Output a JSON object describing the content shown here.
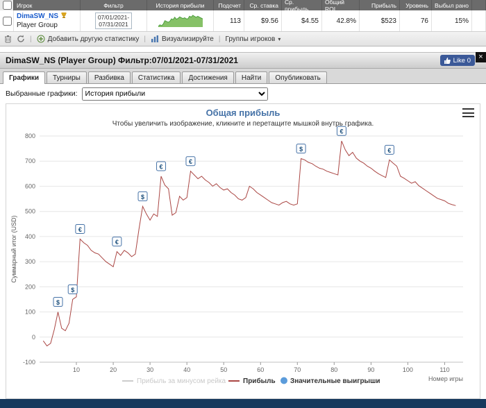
{
  "colors": {
    "profit_line": "#AA4643",
    "disabled_series": "#cccccc",
    "marker_dot": "#5B9CDB",
    "marker_border": "#4572A7",
    "facebook_blue": "#3b5998",
    "footer_navy": "#17395d",
    "player_link_blue": "#1a5ccc",
    "sparkline_green": "#86C167"
  },
  "table": {
    "headers": {
      "player": "Игрок",
      "filter": "Фильтр",
      "history": "История прибыли",
      "count": "Подсчет",
      "avg_stake": "Ср. ставка",
      "avg_profit": "Ср. прибыль",
      "roi": "Общий ROI",
      "profit": "Прибыль",
      "level": "Уровень",
      "busted": "Выбыл рано"
    },
    "row": {
      "player": "DimaSW_NS",
      "group": "Player Group",
      "filter_line1": "07/01/2021-",
      "filter_line2": "07/31/2021",
      "count": "113",
      "avg_stake": "$9.56",
      "avg_profit": "$4.55",
      "roi": "42.8%",
      "profit": "$523",
      "level": "76",
      "busted": "15%"
    },
    "sparkline": [
      -15,
      100,
      35,
      150,
      390,
      340,
      280,
      345,
      520,
      465,
      640,
      495,
      555,
      660,
      600,
      545,
      600,
      525,
      530,
      710,
      650,
      780,
      700,
      635,
      705,
      640,
      580,
      523
    ]
  },
  "toolbar": {
    "add_stat": "Добавить другую статистику",
    "visualize": "Визуализируйте",
    "groups": "Группы игроков"
  },
  "panel": {
    "title": "DimaSW_NS (Player Group) Фильтр:07/01/2021-07/31/2021",
    "like": "Like 0",
    "close": "×",
    "tabs": [
      "Графики",
      "Турниры",
      "Разбивка",
      "Статистика",
      "Достижения",
      "Найти",
      "Опубликовать"
    ],
    "active_tab": "Графики",
    "graphs_label": "Выбранные графики:",
    "graph_selected": "История прибыли"
  },
  "chart_data": {
    "type": "line",
    "title": "Общая прибыль",
    "subtitle": "Чтобы увеличить изображение, кликните и перетащите мышкой внутрь графика.",
    "ylabel": "Суммарный итог (USD)",
    "xlabel": "Номер игры",
    "xlim": [
      0,
      115
    ],
    "ylim": [
      -100,
      800
    ],
    "xticks": [
      10,
      20,
      30,
      40,
      50,
      60,
      70,
      80,
      90,
      100,
      110
    ],
    "yticks": [
      -100,
      0,
      100,
      200,
      300,
      400,
      500,
      600,
      700,
      800
    ],
    "grid": "horizontal",
    "legend_position": "bottom",
    "series": [
      {
        "name": "Прибыль за минусом рейка",
        "color": "#cccccc",
        "visible": false,
        "points": []
      },
      {
        "name": "Прибыль",
        "color": "#AA4643",
        "visible": true,
        "points": [
          [
            1,
            -15
          ],
          [
            2,
            -35
          ],
          [
            3,
            -25
          ],
          [
            4,
            30
          ],
          [
            5,
            100
          ],
          [
            6,
            35
          ],
          [
            7,
            25
          ],
          [
            8,
            55
          ],
          [
            9,
            150
          ],
          [
            10,
            160
          ],
          [
            11,
            390
          ],
          [
            12,
            375
          ],
          [
            13,
            365
          ],
          [
            14,
            345
          ],
          [
            15,
            335
          ],
          [
            16,
            330
          ],
          [
            17,
            315
          ],
          [
            18,
            300
          ],
          [
            19,
            290
          ],
          [
            20,
            280
          ],
          [
            21,
            340
          ],
          [
            22,
            325
          ],
          [
            23,
            345
          ],
          [
            24,
            335
          ],
          [
            25,
            320
          ],
          [
            26,
            330
          ],
          [
            27,
            430
          ],
          [
            28,
            520
          ],
          [
            29,
            490
          ],
          [
            30,
            465
          ],
          [
            31,
            490
          ],
          [
            32,
            480
          ],
          [
            33,
            640
          ],
          [
            34,
            605
          ],
          [
            35,
            590
          ],
          [
            36,
            485
          ],
          [
            37,
            495
          ],
          [
            38,
            560
          ],
          [
            39,
            545
          ],
          [
            40,
            555
          ],
          [
            41,
            660
          ],
          [
            42,
            645
          ],
          [
            43,
            630
          ],
          [
            44,
            640
          ],
          [
            45,
            625
          ],
          [
            46,
            615
          ],
          [
            47,
            600
          ],
          [
            48,
            610
          ],
          [
            49,
            595
          ],
          [
            50,
            585
          ],
          [
            51,
            590
          ],
          [
            52,
            575
          ],
          [
            53,
            565
          ],
          [
            54,
            550
          ],
          [
            55,
            545
          ],
          [
            56,
            555
          ],
          [
            57,
            600
          ],
          [
            58,
            590
          ],
          [
            59,
            575
          ],
          [
            60,
            565
          ],
          [
            61,
            555
          ],
          [
            62,
            545
          ],
          [
            63,
            535
          ],
          [
            64,
            530
          ],
          [
            65,
            525
          ],
          [
            66,
            535
          ],
          [
            67,
            540
          ],
          [
            68,
            530
          ],
          [
            69,
            525
          ],
          [
            70,
            530
          ],
          [
            71,
            710
          ],
          [
            72,
            705
          ],
          [
            73,
            695
          ],
          [
            74,
            690
          ],
          [
            75,
            680
          ],
          [
            76,
            672
          ],
          [
            77,
            668
          ],
          [
            78,
            660
          ],
          [
            79,
            655
          ],
          [
            80,
            650
          ],
          [
            81,
            645
          ],
          [
            82,
            780
          ],
          [
            83,
            745
          ],
          [
            84,
            722
          ],
          [
            85,
            735
          ],
          [
            86,
            712
          ],
          [
            87,
            700
          ],
          [
            88,
            692
          ],
          [
            89,
            680
          ],
          [
            90,
            672
          ],
          [
            91,
            660
          ],
          [
            92,
            650
          ],
          [
            93,
            642
          ],
          [
            94,
            635
          ],
          [
            95,
            705
          ],
          [
            96,
            692
          ],
          [
            97,
            680
          ],
          [
            98,
            640
          ],
          [
            99,
            632
          ],
          [
            100,
            622
          ],
          [
            101,
            612
          ],
          [
            102,
            618
          ],
          [
            103,
            602
          ],
          [
            104,
            592
          ],
          [
            105,
            582
          ],
          [
            106,
            572
          ],
          [
            107,
            562
          ],
          [
            108,
            552
          ],
          [
            109,
            547
          ],
          [
            110,
            542
          ],
          [
            111,
            532
          ],
          [
            112,
            527
          ],
          [
            113,
            523
          ]
        ]
      }
    ],
    "markers": {
      "name": "Значительные выигрыши",
      "color": "#5B9CDB",
      "border": "#4572A7",
      "items": [
        {
          "x": 5,
          "y": 100,
          "symbol": "$"
        },
        {
          "x": 9,
          "y": 150,
          "symbol": "$"
        },
        {
          "x": 11,
          "y": 390,
          "symbol": "€"
        },
        {
          "x": 21,
          "y": 340,
          "symbol": "€"
        },
        {
          "x": 28,
          "y": 520,
          "symbol": "$"
        },
        {
          "x": 33,
          "y": 640,
          "symbol": "€"
        },
        {
          "x": 41,
          "y": 660,
          "symbol": "€"
        },
        {
          "x": 71,
          "y": 710,
          "symbol": "$"
        },
        {
          "x": 82,
          "y": 780,
          "symbol": "€"
        },
        {
          "x": 95,
          "y": 705,
          "symbol": "€"
        }
      ]
    }
  }
}
